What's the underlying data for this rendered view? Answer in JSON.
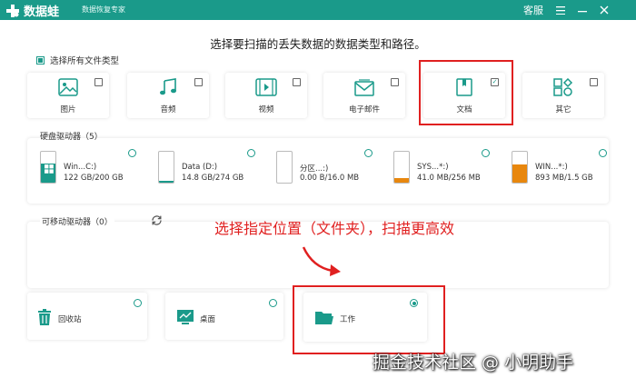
{
  "app": {
    "name": "数据蛙",
    "tagline": "数据恢复专家",
    "support_label": "客服",
    "accent_color": "#1a9a8a",
    "highlight_color": "#e02020"
  },
  "heading": "选择要扫描的丢失数据的数据类型和路径。",
  "select_all": {
    "label": "选择所有文件类型",
    "checked": true
  },
  "file_types": [
    {
      "label": "图片",
      "icon": "image-icon",
      "checked": false
    },
    {
      "label": "音频",
      "icon": "music-icon",
      "checked": false
    },
    {
      "label": "视频",
      "icon": "video-icon",
      "checked": false
    },
    {
      "label": "电子邮件",
      "icon": "mail-icon",
      "checked": false
    },
    {
      "label": "文档",
      "icon": "document-icon",
      "checked": true
    },
    {
      "label": "其它",
      "icon": "other-icon",
      "checked": false
    }
  ],
  "hard_drives": {
    "title": "硬盘驱动器（5）",
    "drives": [
      {
        "name": "Win...C:)",
        "size": "122 GB/200 GB",
        "used_fraction": 0.61,
        "fill_color": "#1a9a8a",
        "windows": true
      },
      {
        "name": "Data (D:)",
        "size": "14.8 GB/274 GB",
        "used_fraction": 0.05,
        "fill_color": "#1a9a8a",
        "windows": false
      },
      {
        "name": "分区...:)",
        "size": "0.00  B/16.0 MB",
        "used_fraction": 0,
        "fill_color": "#e8870e",
        "windows": false
      },
      {
        "name": "SYS...*:)",
        "size": "41.0 MB/256 MB",
        "used_fraction": 0.16,
        "fill_color": "#e8870e",
        "windows": false
      },
      {
        "name": "WIN...*:)",
        "size": "893 MB/1.5 GB",
        "used_fraction": 0.58,
        "fill_color": "#e8870e",
        "windows": false
      }
    ]
  },
  "removable": {
    "title": "可移动驱动器（0）"
  },
  "annotation": "选择指定位置（文件夹），扫描更高效",
  "locations": [
    {
      "label": "回收站",
      "icon": "trash-icon",
      "selected": false
    },
    {
      "label": "桌面",
      "icon": "desktop-icon",
      "selected": false
    },
    {
      "label": "工作",
      "icon": "folder-icon",
      "selected": true
    }
  ],
  "watermark": "掘金技术社区 @ 小明助手"
}
